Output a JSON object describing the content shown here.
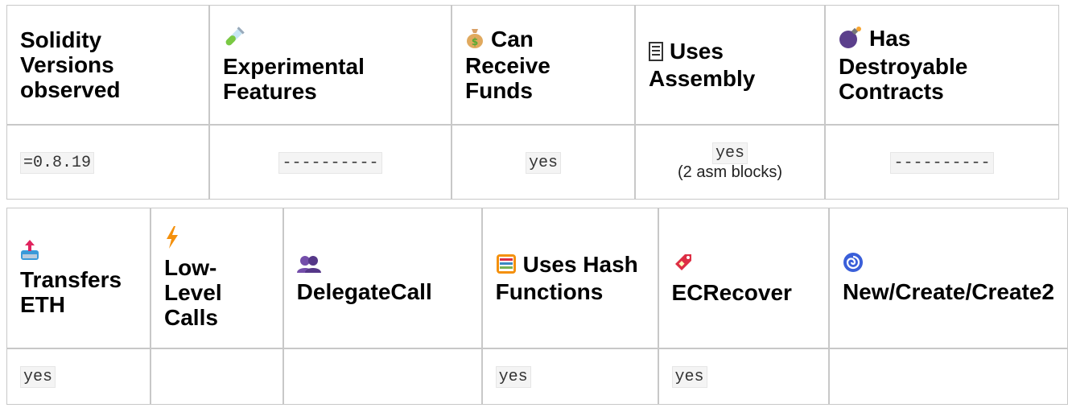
{
  "table1": {
    "headers": [
      {
        "icon": "",
        "label": "Solidity Versions observed"
      },
      {
        "icon": "test-tube-icon",
        "label": "Experimental Features"
      },
      {
        "icon": "money-bag-icon",
        "label": "Can Receive Funds"
      },
      {
        "icon": "memo-icon",
        "label": "Uses Assembly"
      },
      {
        "icon": "bomb-icon",
        "label": "Has Destroyable Contracts"
      }
    ],
    "values": [
      {
        "code": "=0.8.19",
        "note": ""
      },
      {
        "code": "----------",
        "note": ""
      },
      {
        "code": "yes",
        "note": ""
      },
      {
        "code": "yes",
        "note": "(2 asm blocks)"
      },
      {
        "code": "----------",
        "note": ""
      }
    ]
  },
  "table2": {
    "headers": [
      {
        "icon": "outbox-tray-icon",
        "label": "Transfers ETH"
      },
      {
        "icon": "lightning-icon",
        "label": "Low-Level Calls"
      },
      {
        "icon": "busts-icon",
        "label": "DelegateCall"
      },
      {
        "icon": "abacus-icon",
        "label": "Uses Hash Functions"
      },
      {
        "icon": "tag-icon",
        "label": "ECRecover"
      },
      {
        "icon": "cyclone-icon",
        "label": "New/Create/Create2"
      }
    ],
    "values": [
      "yes",
      "",
      "",
      "yes",
      "yes",
      ""
    ]
  },
  "colors": {
    "border": "#c8c8c8",
    "code_bg": "#f4f4f4"
  }
}
